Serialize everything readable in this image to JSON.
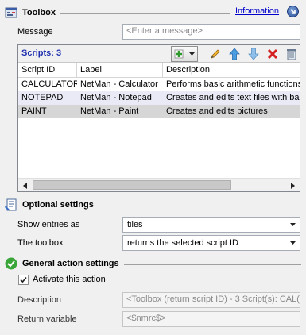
{
  "toolbox_section": {
    "title": "Toolbox",
    "info_link": "Information"
  },
  "message": {
    "label": "Message",
    "placeholder": "<Enter a message>"
  },
  "scripts": {
    "count_label": "Scripts: 3",
    "columns": [
      "Script ID",
      "Label",
      "Description"
    ],
    "rows": [
      {
        "id": "CALCULATOR",
        "label": "NetMan - Calculator",
        "description": "Performs basic arithmetic functions"
      },
      {
        "id": "NOTEPAD",
        "label": "NetMan - Notepad",
        "description": "Creates and edits text files with ba"
      },
      {
        "id": "PAINT",
        "label": "NetMan - Paint",
        "description": "Creates and edits pictures"
      }
    ]
  },
  "optional_section": {
    "title": "Optional settings",
    "show_entries_label": "Show entries as",
    "show_entries_value": "tiles",
    "toolbox_label": "The toolbox",
    "toolbox_value": "returns the selected script ID"
  },
  "general_section": {
    "title": "General action settings",
    "activate_label": "Activate this action",
    "description_label": "Description",
    "description_value": "<Toolbox (return script ID) - 3 Script(s): CAL(",
    "return_label": "Return variable",
    "return_value": "<$nmrc$>"
  },
  "colors": {
    "accent_blue": "#1e2fb0",
    "link": "#0000cc",
    "selected_row": "#d6d6d6",
    "alt_row": "#eaeaf6"
  }
}
